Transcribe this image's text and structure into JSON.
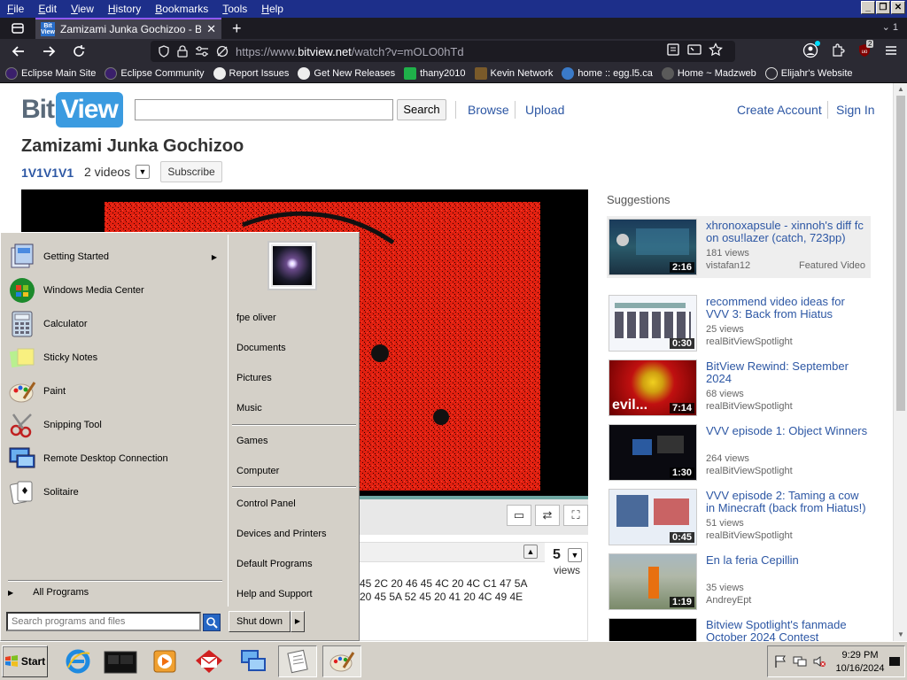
{
  "menubar": {
    "items": [
      "File",
      "Edit",
      "View",
      "History",
      "Bookmarks",
      "Tools",
      "Help"
    ]
  },
  "browser": {
    "tab_title": "Zamizami Junka Gochizoo - BitView",
    "tab_count_label": "1",
    "favicon_text": "Bit View",
    "url_prefix": "https://www.",
    "url_domain": "bitview.net",
    "url_path": "/watch?v=mOLO0hTd",
    "ublock_badge": "2"
  },
  "bookmarks": [
    {
      "label": "Eclipse Main Site",
      "color": "#3a1f6b"
    },
    {
      "label": "Eclipse Community",
      "color": "#3a1f6b"
    },
    {
      "label": "Report Issues",
      "color": "#eeeeee"
    },
    {
      "label": "Get New Releases",
      "color": "#eeeeee"
    },
    {
      "label": "thany2010",
      "color": "#1fb14a"
    },
    {
      "label": "Kevin Network",
      "color": "#7a5a2a"
    },
    {
      "label": "home :: egg.l5.ca",
      "color": "#3a7ac8"
    },
    {
      "label": "Home ~ Madzweb",
      "color": "#5a5a5a"
    },
    {
      "label": "Elijahr's Website",
      "color": "#dddddd"
    }
  ],
  "site": {
    "logo_bit": "Bit",
    "logo_view": "View",
    "search_button": "Search",
    "nav": [
      "Browse",
      "Upload"
    ],
    "account": [
      "Create Account",
      "Sign In"
    ]
  },
  "video": {
    "title": "Zamizami Junka Gochizoo",
    "channel": "1V1V1V1",
    "video_count": "2 videos",
    "subscribe": "Subscribe",
    "views": "5",
    "views_label": "views",
    "hex_lines": [
      "45 2C 20 46 45 4C 20 4C C1 47 5A",
      "20 45 5A 52 45 20 41 20 4C 49 4E"
    ]
  },
  "suggestions": {
    "heading": "Suggestions",
    "items": [
      {
        "title": "xhronoxapsulе - xinnoh's diff fc on osu!lazer (catch, 723pp)",
        "views": "181 views",
        "user": "vistafan12",
        "tag": "Featured Video",
        "duration": "2:16"
      },
      {
        "title": "recommend video ideas for VVV 3: Back from Hiatus",
        "views": "25 views",
        "user": "realBitViewSpotlight",
        "duration": "0:30"
      },
      {
        "title": "BitView Rewind: September 2024",
        "views": "68 views",
        "user": "realBitViewSpotlight",
        "duration": "7:14",
        "thumb_text": "evil..."
      },
      {
        "title": "VVV episode 1: Object Winners",
        "views": "264 views",
        "user": "realBitViewSpotlight",
        "duration": "1:30"
      },
      {
        "title": "VVV episode 2: Taming a cow in Minecraft (back from Hiatus!)",
        "views": "51 views",
        "user": "realBitViewSpotlight",
        "duration": "0:45"
      },
      {
        "title": "En la feria Cepillin",
        "views": "35 views",
        "user": "AndreyEpt",
        "duration": "1:19"
      },
      {
        "title": "Bitview Spotlight's fanmade October 2024 Contest",
        "views": "",
        "user": "",
        "duration": ""
      }
    ]
  },
  "start_menu": {
    "left_items": [
      {
        "label": "Getting Started",
        "icon": "getting-started-icon",
        "has_submenu": true
      },
      {
        "label": "Windows Media Center",
        "icon": "media-center-icon"
      },
      {
        "label": "Calculator",
        "icon": "calculator-icon"
      },
      {
        "label": "Sticky Notes",
        "icon": "sticky-notes-icon"
      },
      {
        "label": "Paint",
        "icon": "paint-icon"
      },
      {
        "label": "Snipping Tool",
        "icon": "snipping-tool-icon"
      },
      {
        "label": "Remote Desktop Connection",
        "icon": "remote-desktop-icon"
      },
      {
        "label": "Solitaire",
        "icon": "solitaire-icon"
      }
    ],
    "all_programs": "All Programs",
    "search_placeholder": "Search programs and files",
    "right_items": [
      "fpe oliver",
      "Documents",
      "Pictures",
      "Music",
      "Games",
      "Computer",
      "Control Panel",
      "Devices and Printers",
      "Default Programs",
      "Help and Support"
    ],
    "shutdown": "Shut down"
  },
  "taskbar": {
    "start_label": "Start",
    "time": "9:29 PM",
    "date": "10/16/2024"
  }
}
